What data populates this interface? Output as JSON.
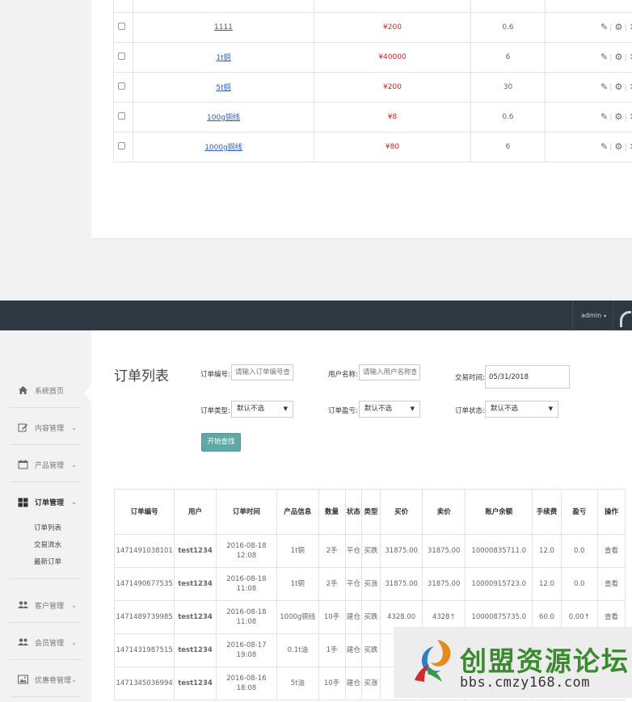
{
  "product_table": {
    "rows": [
      {
        "name": "1111",
        "price": "¥200",
        "qty": "0.6"
      },
      {
        "name": "1t铜",
        "price": "¥40000",
        "qty": "6"
      },
      {
        "name": "5t铜",
        "price": "¥200",
        "qty": "30"
      },
      {
        "name": "100g铜线",
        "price": "¥8",
        "qty": "0.6"
      },
      {
        "name": "1000g铜线",
        "price": "¥80",
        "qty": "6"
      }
    ]
  },
  "navbar": {
    "user": "admin",
    "caret": "▾"
  },
  "sidebar": {
    "items": [
      {
        "label": "系统首页"
      },
      {
        "label": "内容管理"
      },
      {
        "label": "产品管理"
      },
      {
        "label": "订单管理"
      },
      {
        "label": "客户管理"
      },
      {
        "label": "会员管理"
      },
      {
        "label": "优惠卷管理"
      }
    ],
    "subitems": [
      {
        "label": "订单列表"
      },
      {
        "label": "交易流水"
      },
      {
        "label": "最新订单"
      }
    ],
    "chevron": "⌄"
  },
  "filters": {
    "title": "订单列表",
    "order_no_label": "订单编号:",
    "order_no_placeholder": "请输入订单编号查询",
    "username_label": "用户名称:",
    "username_placeholder": "请输入用户名称查询",
    "trade_time_label": "交易时间:",
    "trade_time_value": "05/31/2018",
    "order_type_label": "订单类型:",
    "order_type_value": "默认不选",
    "order_pl_label": "订单盈亏:",
    "order_pl_value": "默认不选",
    "order_status_label": "订单状态:",
    "order_status_value": "默认不选",
    "search_button": "开始查找"
  },
  "orders": {
    "headers": [
      "订单编号",
      "用户",
      "订单时间",
      "产品信息",
      "数量",
      "状态",
      "类型",
      "买价",
      "卖价",
      "账户余额",
      "手续费",
      "盈亏",
      "操作"
    ],
    "rows": [
      {
        "id": "1471491038101",
        "user": "test1234",
        "date": "2016-08-18",
        "time": "12:08",
        "product": "1t铜",
        "qty": "2手",
        "status": "平仓",
        "type": "买跌",
        "buy": "31875.00",
        "sell": "31875.00",
        "balance": "10000835711.0",
        "fee": "12.0",
        "pl": "0.0",
        "op": "查看"
      },
      {
        "id": "1471490677535",
        "user": "test1234",
        "date": "2016-08-18",
        "time": "11:08",
        "product": "1t铜",
        "qty": "2手",
        "status": "平仓",
        "type": "买涨",
        "buy": "31875.00",
        "sell": "31875.00",
        "balance": "10000915723.0",
        "fee": "12.0",
        "pl": "0.0",
        "op": "查看"
      },
      {
        "id": "1471489739985",
        "user": "test1234",
        "date": "2016-08-18",
        "time": "11:08",
        "product": "1000g铜线",
        "qty": "10手",
        "status": "建仓",
        "type": "买跌",
        "buy": "4328.00",
        "sell": "4328↑",
        "balance": "10000875735.0",
        "fee": "60.0",
        "pl": "0.00↑",
        "op": "查看"
      },
      {
        "id": "1471431987515",
        "user": "test1234",
        "date": "2016-08-17",
        "time": "19:08",
        "product": "0.1t油",
        "qty": "1手",
        "status": "建仓",
        "type": "买跌",
        "buy": "",
        "sell": "",
        "balance": "",
        "fee": "",
        "pl": "",
        "op": ""
      },
      {
        "id": "1471345036994",
        "user": "test1234",
        "date": "2016-08-16",
        "time": "18:08",
        "product": "5t油",
        "qty": "10手",
        "status": "建仓",
        "type": "买涨",
        "buy": "",
        "sell": "",
        "balance": "",
        "fee": "",
        "pl": "",
        "op": ""
      }
    ]
  },
  "watermark": {
    "title": "创盟资源论坛",
    "url": "bbs.cmzy168.com"
  },
  "colors": {
    "navbar": "#2e3840",
    "search_button": "#5fa8a6",
    "price_red": "#cc2222",
    "up_green": "#3a9a44",
    "link_blue": "#2a5db0",
    "watermark_green": "#3a8a2e"
  }
}
